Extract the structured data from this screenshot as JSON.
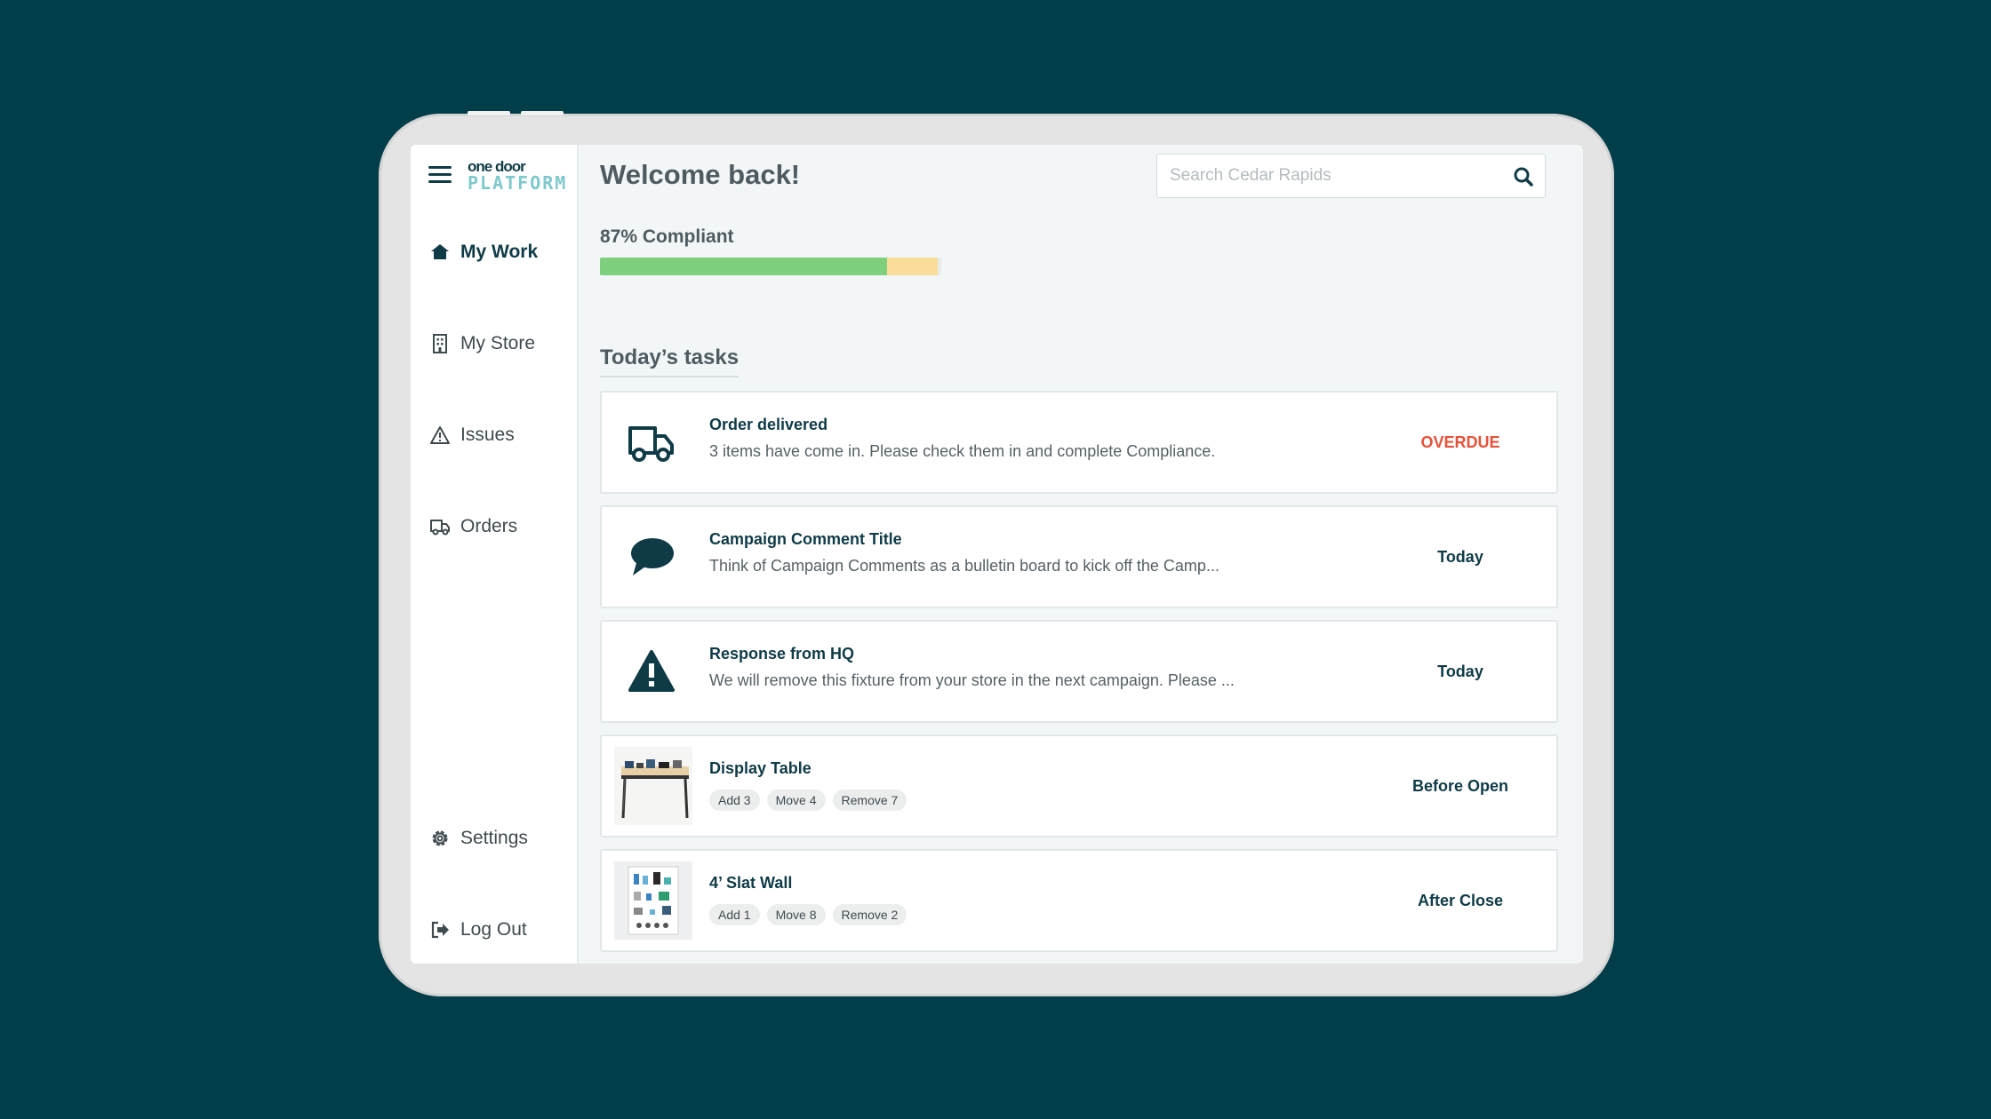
{
  "colors": {
    "background": "#023d4a",
    "brand": "#0f3b47",
    "overdue": "#e5523a",
    "progress_green": "#7ed07f",
    "progress_yellow": "#f9dc97"
  },
  "sidebar": {
    "logo": {
      "line1": "one door",
      "line2": "PLATFORM"
    },
    "items": [
      {
        "label": "My Work",
        "icon": "home-icon",
        "active": true
      },
      {
        "label": "My Store",
        "icon": "building-icon"
      },
      {
        "label": "Issues",
        "icon": "warning-icon"
      },
      {
        "label": "Orders",
        "icon": "truck-icon"
      }
    ],
    "bottom_items": [
      {
        "label": "Settings",
        "icon": "gear-icon"
      },
      {
        "label": "Log Out",
        "icon": "logout-icon"
      }
    ]
  },
  "header": {
    "welcome": "Welcome back!",
    "search_placeholder": "Search Cedar Rapids"
  },
  "compliance": {
    "label": "87% Compliant",
    "complete_fraction": 0.84,
    "pending_fraction": 0.15
  },
  "tasks_heading": "Today’s tasks",
  "tasks": [
    {
      "title": "Order delivered",
      "description": "3 items have come in. Please check them in and complete Compliance.",
      "status": "OVERDUE",
      "icon": "truck-icon"
    },
    {
      "title": "Campaign Comment Title",
      "description": "Think of Campaign Comments as a bulletin board to kick off the Camp...",
      "status": "Today",
      "icon": "speech-bubble-icon"
    },
    {
      "title": "Response from HQ",
      "description": "We will remove this fixture from your store in the next campaign. Please ...",
      "status": "Today",
      "icon": "warning-icon"
    },
    {
      "title": "Display Table",
      "pills": [
        "Add 3",
        "Move 4",
        "Remove 7"
      ],
      "status": "Before Open",
      "icon": "display-table-thumbnail"
    },
    {
      "title": "4’ Slat Wall",
      "pills": [
        "Add 1",
        "Move 8",
        "Remove 2"
      ],
      "status": "After Close",
      "icon": "slat-wall-thumbnail"
    }
  ],
  "help_button_icon": "help-chat-icon"
}
